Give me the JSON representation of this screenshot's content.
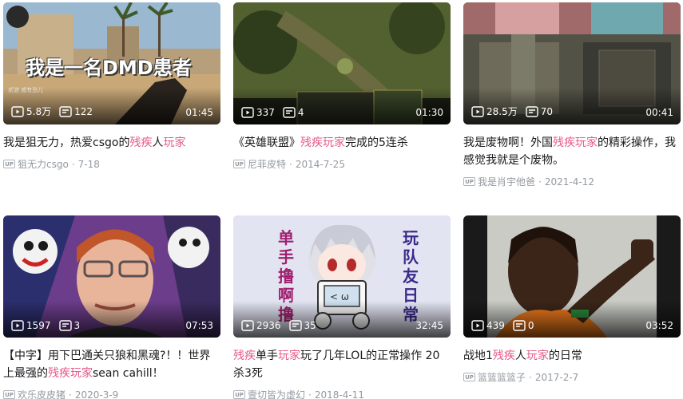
{
  "cards": [
    {
      "views": "5.8万",
      "danmaku": "122",
      "duration": "01:45",
      "title": [
        {
          "t": "我是狙无力，热爱csgo的"
        },
        {
          "t": "残疾",
          "hl": true
        },
        {
          "t": "人"
        },
        {
          "t": "玩家",
          "hl": true
        }
      ],
      "author": "狙无力csgo",
      "date": "7-18",
      "overlay": "我是一名DMD患者",
      "overlay_small": "贰波 戚有劲儿"
    },
    {
      "views": "337",
      "danmaku": "4",
      "duration": "01:30",
      "title": [
        {
          "t": "《英雄联盟》"
        },
        {
          "t": "残疾玩家",
          "hl": true
        },
        {
          "t": "完成的5连杀"
        }
      ],
      "author": "尼菲皮特",
      "date": "2014-7-25"
    },
    {
      "views": "28.5万",
      "danmaku": "70",
      "duration": "00:41",
      "title": [
        {
          "t": "我是废物啊！外国"
        },
        {
          "t": "残疾玩家",
          "hl": true
        },
        {
          "t": "的精彩操作，我感觉我就是个废物。"
        }
      ],
      "author": "我是肖宇他爸",
      "date": "2021-4-12"
    },
    {
      "views": "1597",
      "danmaku": "3",
      "duration": "07:53",
      "title": [
        {
          "t": "【中字】用下巴通关只狼和黑魂?！！世界上最强的"
        },
        {
          "t": "残疾玩家",
          "hl": true
        },
        {
          "t": "sean cahill！"
        }
      ],
      "author": "欢乐皮皮猪",
      "date": "2020-3-9"
    },
    {
      "views": "2936",
      "danmaku": "35",
      "duration": "32:45",
      "title": [
        {
          "t": "残疾",
          "hl": true
        },
        {
          "t": "单手"
        },
        {
          "t": "玩家",
          "hl": true
        },
        {
          "t": "玩了几年LOL的正常操作 20杀3死"
        }
      ],
      "author": "壹切皆为虚幻",
      "date": "2018-4-11",
      "overlay_left": "单手撸啊撸",
      "overlay_right": "玩队友日常"
    },
    {
      "views": "439",
      "danmaku": "0",
      "duration": "03:52",
      "title": [
        {
          "t": "战地1"
        },
        {
          "t": "残疾",
          "hl": true
        },
        {
          "t": "人"
        },
        {
          "t": "玩家",
          "hl": true
        },
        {
          "t": "的日常"
        }
      ],
      "author": "篮篮篮篮子",
      "date": "2017-2-7"
    }
  ],
  "up_badge": "UP",
  "colors": {
    "highlight": "#e75a87",
    "meta": "#9499a0"
  },
  "icons": {
    "views": "play-count-icon",
    "danmaku": "danmaku-icon",
    "author": "up-badge-icon"
  }
}
